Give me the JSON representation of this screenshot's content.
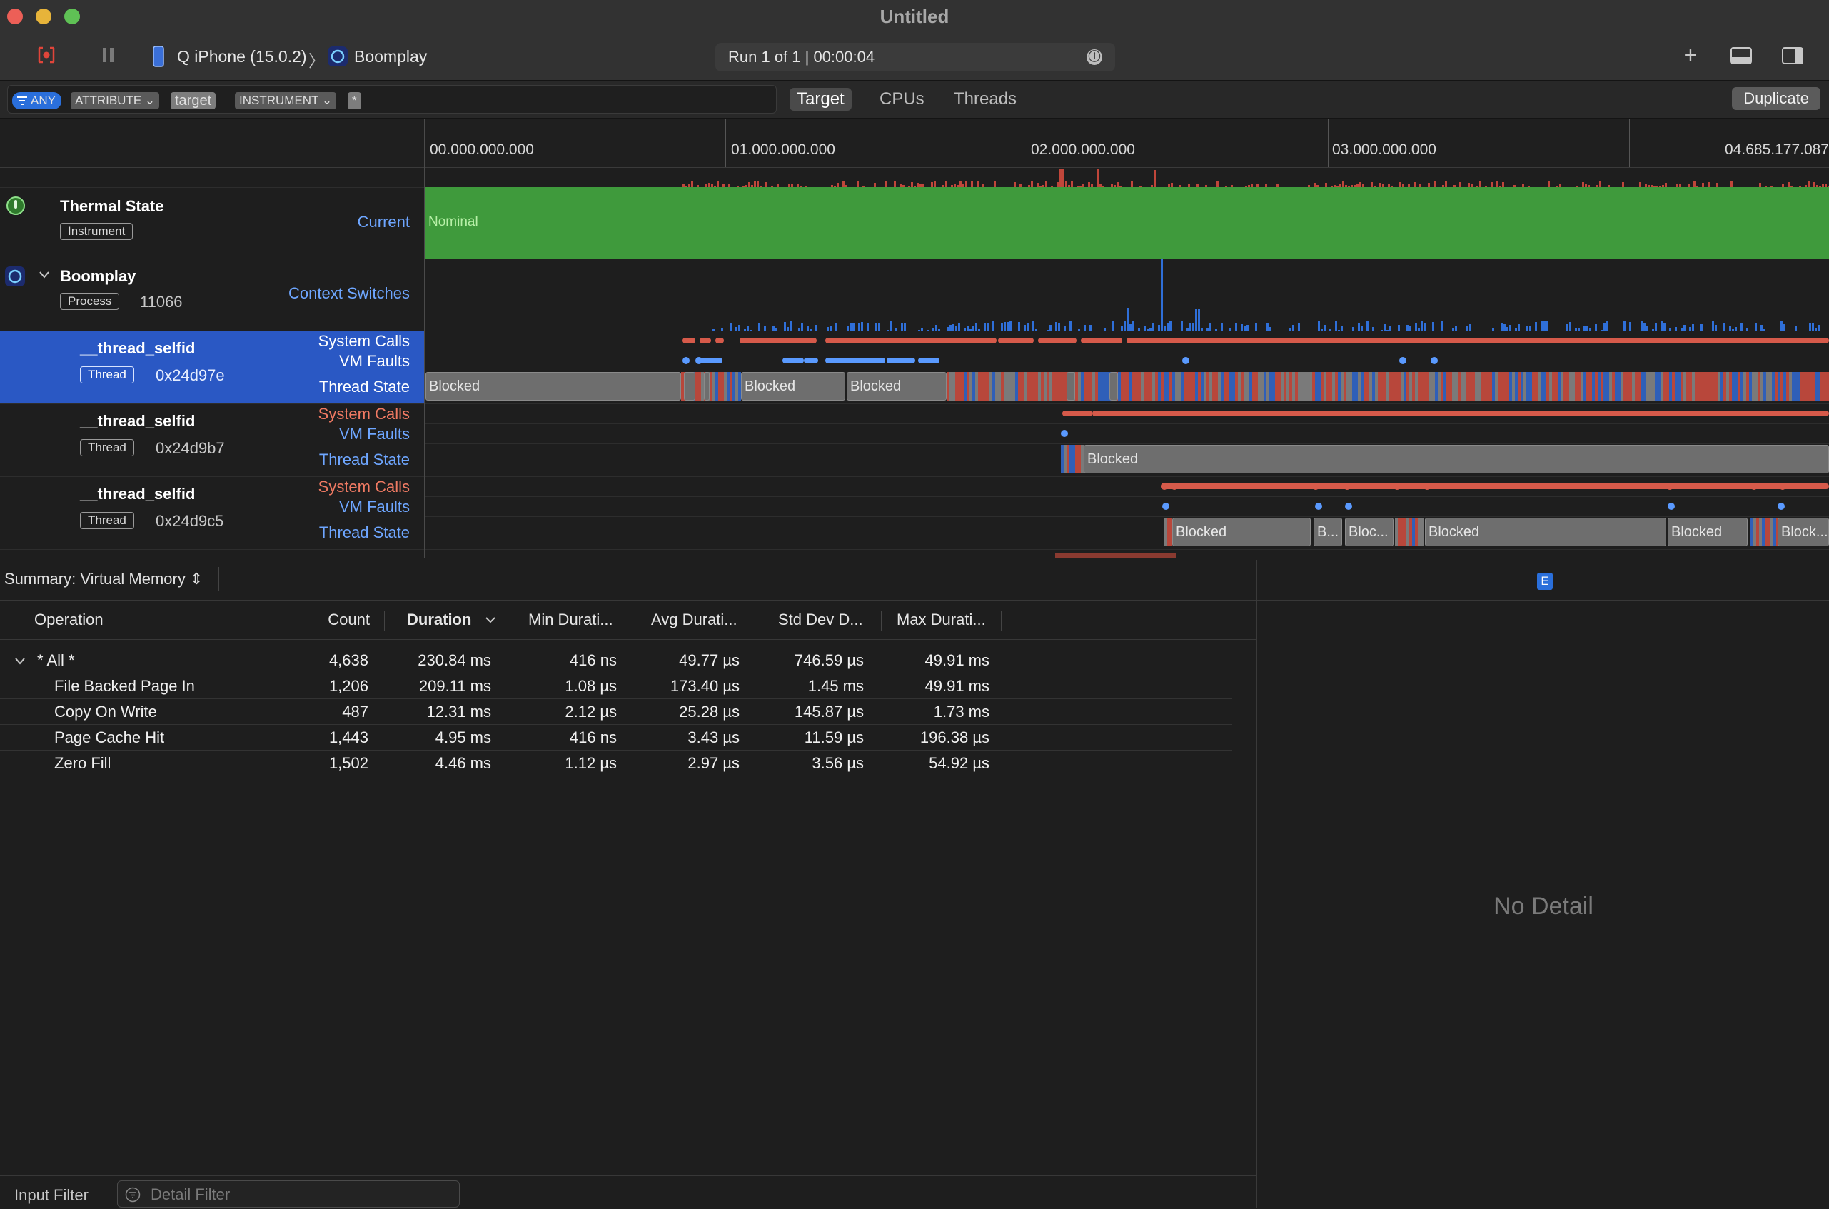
{
  "window": {
    "title": "Untitled"
  },
  "toolbar": {
    "device": "Q iPhone (15.0.2)",
    "separator": "〉",
    "target_app": "Boomplay",
    "run_status": "Run 1 of 1  |  00:00:04",
    "info_icon": "ⓘ",
    "add_icon": "+",
    "colors": {
      "record_red": "#e0453a"
    }
  },
  "filter": {
    "tokens": [
      "ANY",
      "ATTRIBUTE ⌄",
      "target",
      "INSTRUMENT ⌄",
      "*"
    ],
    "scopes": [
      "Target",
      "CPUs",
      "Threads"
    ],
    "selected_scope": "Target",
    "duplicate_label": "Duplicate"
  },
  "timeline": {
    "ticks": [
      "00.000.000.000",
      "01.000.000.000",
      "02.000.000.000",
      "03.000.000.000",
      "04.685.177.087"
    ],
    "tracks": [
      {
        "title": "Thermal State",
        "badge": "Instrument",
        "lane_label": "Current",
        "value_label": "Nominal"
      },
      {
        "title": "Boomplay",
        "badge": "Process",
        "pid": "11066",
        "lane_label": "Context Switches"
      },
      {
        "title": "__thread_selfid",
        "badge": "Thread",
        "tid": "0x24d97e",
        "lanes": [
          "System Calls",
          "VM Faults",
          "Thread State"
        ]
      },
      {
        "title": "__thread_selfid",
        "badge": "Thread",
        "tid": "0x24d9b7",
        "lanes": [
          "System Calls",
          "VM Faults",
          "Thread State"
        ]
      },
      {
        "title": "__thread_selfid",
        "badge": "Thread",
        "tid": "0x24d9c5",
        "lanes": [
          "System Calls",
          "VM Faults",
          "Thread State"
        ]
      }
    ],
    "blocked_labels": {
      "t1": [
        "Blocked",
        "Blocked",
        "Blocked"
      ],
      "t2": [
        "Blocked"
      ],
      "t3": [
        "Blocked",
        "B...",
        "Bloc...",
        "Blocked",
        "Blocked",
        "Block..."
      ]
    },
    "colors": {
      "thermal_green": "#3f9a3c",
      "context_blue": "#2f6fd8",
      "syscall_red": "#d65a4a",
      "vm_blue": "#5a9aff",
      "selected_row": "#2a58c4"
    }
  },
  "summary": {
    "label": "Summary: Virtual Memory ⇕",
    "columns": [
      "Operation",
      "Count",
      "Duration",
      "Min Durati...",
      "Avg Durati...",
      "Std Dev D...",
      "Max Durati..."
    ],
    "sorted_column": "Duration",
    "rows": [
      {
        "op": "* All *",
        "count": "4,638",
        "duration": "230.84 ms",
        "min": "416 ns",
        "avg": "49.77 µs",
        "std": "746.59 µs",
        "max": "49.91 ms"
      },
      {
        "op": "File Backed Page In",
        "count": "1,206",
        "duration": "209.11 ms",
        "min": "1.08 µs",
        "avg": "173.40 µs",
        "std": "1.45 ms",
        "max": "49.91 ms"
      },
      {
        "op": "Copy On Write",
        "count": "487",
        "duration": "12.31 ms",
        "min": "2.12 µs",
        "avg": "25.28 µs",
        "std": "145.87 µs",
        "max": "1.73 ms"
      },
      {
        "op": "Page Cache Hit",
        "count": "1,443",
        "duration": "4.95 ms",
        "min": "416 ns",
        "avg": "3.43 µs",
        "std": "11.59 µs",
        "max": "196.38 µs"
      },
      {
        "op": "Zero Fill",
        "count": "1,502",
        "duration": "4.46 ms",
        "min": "1.12 µs",
        "avg": "2.97 µs",
        "std": "3.56 µs",
        "max": "54.92 µs"
      }
    ]
  },
  "detail": {
    "badge": "E",
    "empty_text": "No Detail"
  },
  "bottom": {
    "input_filter_label": "Input Filter",
    "detail_filter_placeholder": "Detail Filter"
  }
}
